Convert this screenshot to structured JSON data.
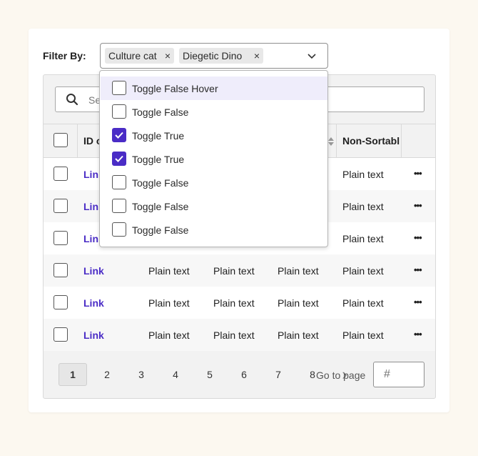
{
  "filter": {
    "label": "Filter By:",
    "chips": [
      {
        "label": "Culture cat",
        "remove": "×"
      },
      {
        "label": "Diegetic Dino",
        "remove": "×"
      }
    ]
  },
  "dropdown": {
    "options": [
      {
        "label": "Toggle False Hover",
        "checked": false,
        "hover": true
      },
      {
        "label": "Toggle False",
        "checked": false
      },
      {
        "label": "Toggle True",
        "checked": true
      },
      {
        "label": "Toggle True",
        "checked": true
      },
      {
        "label": "Toggle False",
        "checked": false
      },
      {
        "label": "Toggle False",
        "checked": false
      },
      {
        "label": "Toggle False",
        "checked": false
      }
    ]
  },
  "search": {
    "placeholder": "Se"
  },
  "table": {
    "headers": [
      "ID o",
      "",
      "",
      "",
      "Non-Sortabl"
    ],
    "rows": [
      [
        "Link",
        "",
        "",
        "",
        "Plain text"
      ],
      [
        "Link",
        "",
        "",
        "",
        "Plain text"
      ],
      [
        "Link",
        "",
        "",
        "",
        "Plain text"
      ],
      [
        "Link",
        "Plain text",
        "Plain text",
        "Plain text",
        "Plain text"
      ],
      [
        "Link",
        "Plain text",
        "Plain text",
        "Plain text",
        "Plain text"
      ],
      [
        "Link",
        "Plain text",
        "Plain text",
        "Plain text",
        "Plain text"
      ]
    ],
    "more": "•••"
  },
  "pagination": {
    "prev": "‹",
    "next": "›",
    "pages": [
      "1",
      "2",
      "3",
      "4",
      "5",
      "6",
      "7",
      "8"
    ],
    "current": "1",
    "goto_label": "Go to page",
    "goto_placeholder": "#"
  },
  "colors": {
    "accent": "#4a2cc6",
    "hover_bg": "#efedfb",
    "page_bg": "#fcf8f0"
  }
}
